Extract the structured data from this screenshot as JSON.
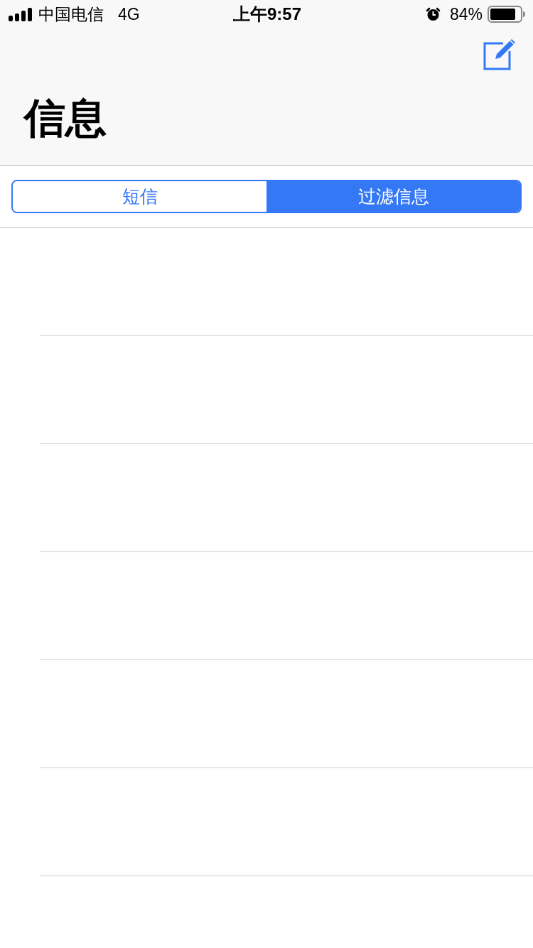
{
  "status_bar": {
    "carrier": "中国电信",
    "network": "4G",
    "time": "上午9:57",
    "battery": "84%"
  },
  "nav": {
    "title": "信息"
  },
  "segments": [
    {
      "label": "短信",
      "selected": false
    },
    {
      "label": "过滤信息",
      "selected": true
    }
  ]
}
